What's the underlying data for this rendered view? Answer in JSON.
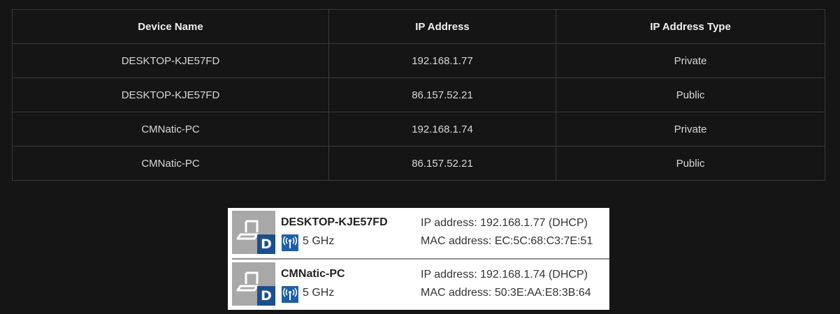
{
  "table": {
    "headers": [
      "Device Name",
      "IP Address",
      "IP Address Type"
    ],
    "rows": [
      [
        "DESKTOP-KJE57FD",
        "192.168.1.77",
        "Private"
      ],
      [
        "DESKTOP-KJE57FD",
        "86.157.52.21",
        "Public"
      ],
      [
        "CMNatic-PC",
        "192.168.1.74",
        "Private"
      ],
      [
        "CMNatic-PC",
        "86.157.52.21",
        "Public"
      ]
    ]
  },
  "devices": [
    {
      "name": "DESKTOP-KJE57FD",
      "badge": "D",
      "band": "5 GHz",
      "ip": "IP address: 192.168.1.77 (DHCP)",
      "mac": "MAC address: EC:5C:68:C3:7E:51",
      "icon": "laptop-icon"
    },
    {
      "name": "CMNatic-PC",
      "badge": "D",
      "band": "5 GHz",
      "ip": "IP address: 192.168.1.74 (DHCP)",
      "mac": "MAC address: 50:3E:AA:E8:3B:64",
      "icon": "laptop-icon"
    }
  ],
  "colors": {
    "background": "#151515",
    "table_border": "#3a3a3a",
    "badge_blue": "#1b4f8c",
    "wifi_blue": "#1b5fa8"
  }
}
